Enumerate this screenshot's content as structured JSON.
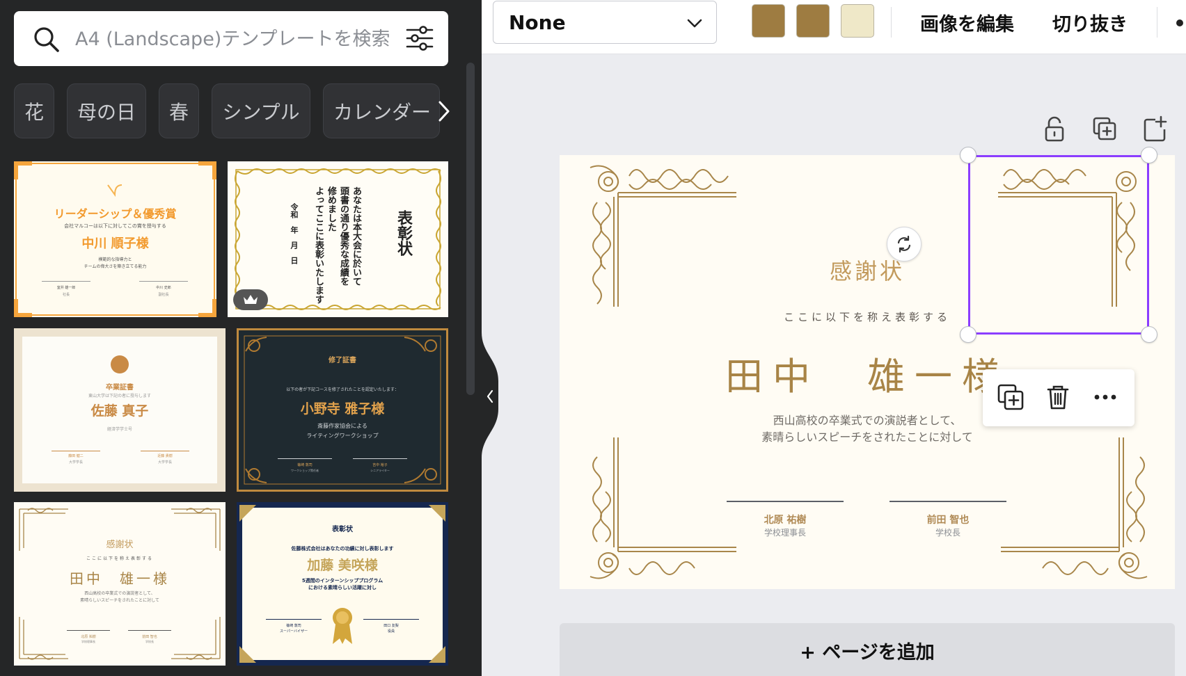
{
  "search": {
    "placeholder": "A4 (Landscape)テンプレートを検索"
  },
  "chips": [
    {
      "label": "花"
    },
    {
      "label": "母の日"
    },
    {
      "label": "春"
    },
    {
      "label": "シンプル"
    },
    {
      "label": "カレンダー"
    }
  ],
  "templates": [
    {
      "title": "リーダーシップ＆優秀賞",
      "line1": "会社マルコーは以下に対してこの賞を授与する",
      "name": "中川 順子様",
      "line2": "模範的な指導力と",
      "line3": "チームの偉大さを築き立てる能力",
      "sig1": "室井 雄一郎",
      "sig1_role": "社長",
      "sig2": "中川 史郎",
      "sig2_role": "副社長"
    },
    {
      "title": "表彰状",
      "col1": "あなたは本大会に於いて",
      "col2": "頭書の通り優秀な成績を",
      "col3": "修めました",
      "col4": "よってここに表彰いたします",
      "date": "令和　年　月　日",
      "premium": "crown-icon"
    },
    {
      "title": "卒業証書",
      "line1": "東山大学は下記の者に授与します",
      "name": "佐藤 真子",
      "line2": "経済学学士号",
      "sig1": "藤田 健二",
      "sig1_role": "大学学長",
      "sig2": "近藤 貴樹",
      "sig2_role": "大学学長"
    },
    {
      "title": "修了証書",
      "line1": "以下の者が下記コースを修了されたことを認定いたします：",
      "name": "小野寺 雅子様",
      "line2": "斎藤作家協会による",
      "line3": "ライティングワークショップ",
      "sig1": "篠崎 敦司",
      "sig1_role": "ワークショップ責任者",
      "sig2": "吉中 裕子",
      "sig2_role": "シニアライター"
    },
    {
      "title": "感謝状",
      "line1": "ここに以下を称え表彰する",
      "name": "田中　雄一様",
      "line2": "西山高校の卒業式での演説者として、",
      "line3": "素晴らしいスピーチをされたことに対して",
      "sig1": "北原 祐樹",
      "sig1_role": "学校理事長",
      "sig2": "前田 智也",
      "sig2_role": "学校長"
    },
    {
      "title": "表彰状",
      "line1": "佐藤株式会社はあなたの功績に対し表彰します",
      "name": "加藤 美咲様",
      "line2": "5週間のインターンシッププログラム",
      "line3": "における素晴らしい活躍に対し",
      "sig1": "篠崎 敦司",
      "sig1_role": "スーパーバイザー",
      "sig2": "田口 友梨",
      "sig2_role": "役員"
    }
  ],
  "toolbar": {
    "font_value": "None",
    "colors": [
      "#9e7c41",
      "#9e7c41",
      "#efe8c8"
    ],
    "edit_image": "画像を編集",
    "crop": "切り抜き"
  },
  "certificate": {
    "title": "感謝状",
    "subtitle": "ここに以下を称え表彰する",
    "name": "田中　雄一様",
    "body_line1": "西山高校の卒業式での演説者として、",
    "body_line2": "素晴らしいスピーチをされたことに対して",
    "signer1_name": "北原 祐樹",
    "signer1_role": "学校理事長",
    "signer2_name": "前田 智也",
    "signer2_role": "学校長"
  },
  "add_page": "+ ページを追加"
}
